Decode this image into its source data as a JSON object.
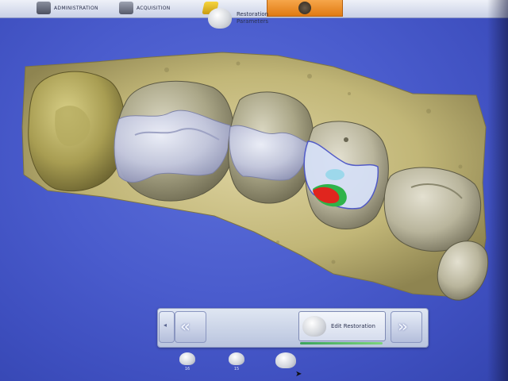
{
  "toolbar": {
    "items": [
      {
        "label": "ADMINISTRATION",
        "icon": "admin-icon"
      },
      {
        "label": "ACQUISITION",
        "icon": "camera-icon"
      },
      {
        "label": "",
        "icon": "model-icon"
      },
      {
        "label": "",
        "icon": "design-icon"
      }
    ]
  },
  "workflow": {
    "steps": [
      {
        "label_line1": "Restoration",
        "label_line2": "Parameters"
      },
      {
        "label_line1": "Edit Restoration",
        "label_line2": ""
      }
    ],
    "active_step_progress": 1.0
  },
  "tooth_selector": {
    "teeth": [
      {
        "number": "16"
      },
      {
        "number": "15"
      },
      {
        "number": ""
      }
    ]
  },
  "colors": {
    "background": "#4a5ccd",
    "scan_model": "#c8bd82",
    "restoration": "#c9cde6",
    "contact_red": "#e0251e",
    "contact_green": "#2fb34a",
    "accent_orange": "#e07a12"
  }
}
